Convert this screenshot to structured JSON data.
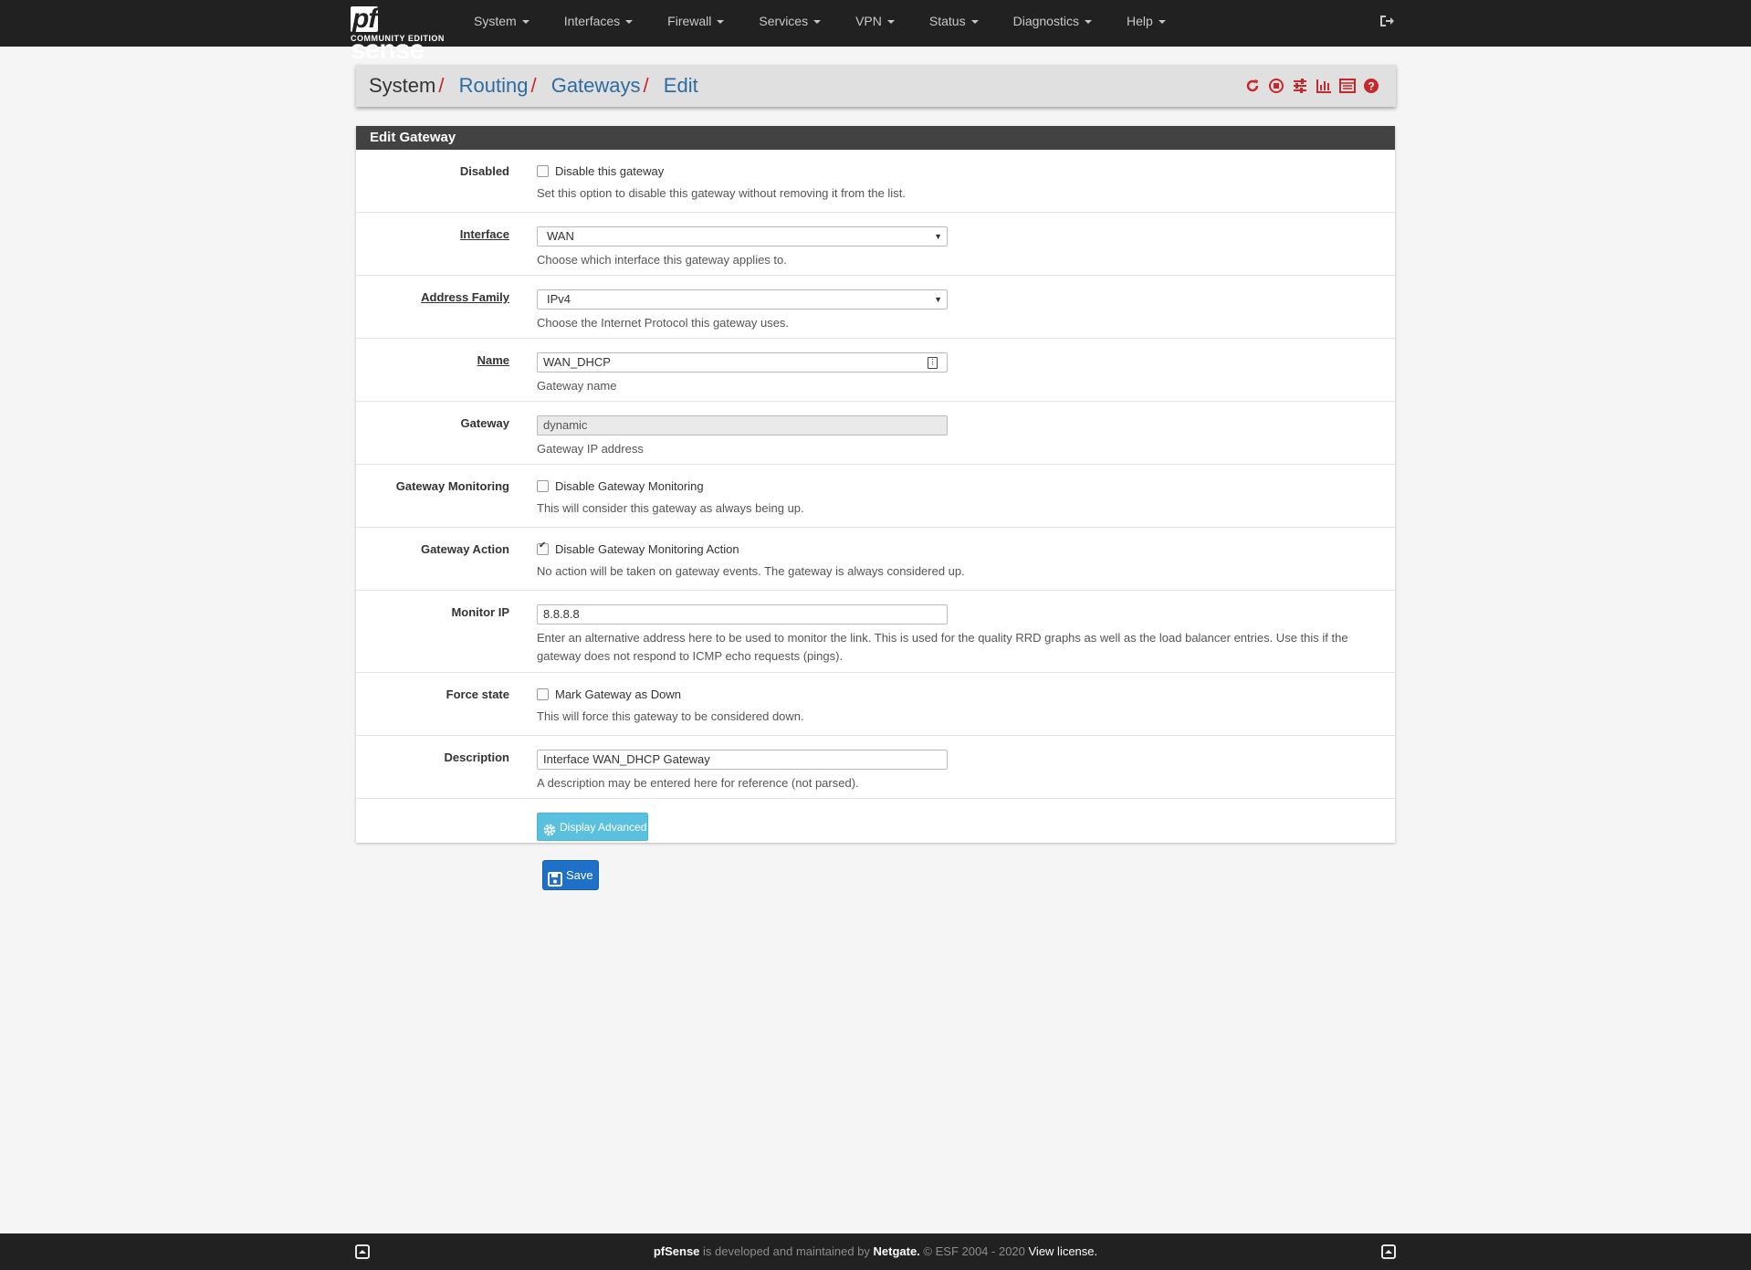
{
  "brand": {
    "name_pf": "pf",
    "name_rest": "sense",
    "edition": "COMMUNITY EDITION"
  },
  "nav": {
    "items": [
      "System",
      "Interfaces",
      "Firewall",
      "Services",
      "VPN",
      "Status",
      "Diagnostics",
      "Help"
    ]
  },
  "breadcrumb": {
    "system": "System",
    "routing": "Routing",
    "gateways": "Gateways",
    "edit": "Edit",
    "separator": "/"
  },
  "panel": {
    "title": "Edit Gateway",
    "fields": {
      "disabled": {
        "label": "Disabled",
        "checkbox_label": "Disable this gateway",
        "checked": false,
        "help": "Set this option to disable this gateway without removing it from the list."
      },
      "interface": {
        "label": "Interface",
        "value": "WAN",
        "help": "Choose which interface this gateway applies to."
      },
      "address_family": {
        "label": "Address Family",
        "value": "IPv4",
        "help": "Choose the Internet Protocol this gateway uses."
      },
      "name": {
        "label": "Name",
        "value": "WAN_DHCP",
        "help": "Gateway name"
      },
      "gateway": {
        "label": "Gateway",
        "value": "dynamic",
        "help": "Gateway IP address"
      },
      "monitoring": {
        "label": "Gateway Monitoring",
        "checkbox_label": "Disable Gateway Monitoring",
        "checked": false,
        "help": "This will consider this gateway as always being up."
      },
      "action": {
        "label": "Gateway Action",
        "checkbox_label": "Disable Gateway Monitoring Action",
        "checked": true,
        "help": "No action will be taken on gateway events. The gateway is always considered up."
      },
      "monitor_ip": {
        "label": "Monitor IP",
        "value": "8.8.8.8",
        "help": "Enter an alternative address here to be used to monitor the link. This is used for the quality RRD graphs as well as the load balancer entries. Use this if the gateway does not respond to ICMP echo requests (pings)."
      },
      "force_state": {
        "label": "Force state",
        "checkbox_label": "Mark Gateway as Down",
        "checked": false,
        "help": "This will force this gateway to be considered down."
      },
      "description": {
        "label": "Description",
        "value": "Interface WAN_DHCP Gateway",
        "help": "A description may be entered here for reference (not parsed)."
      }
    },
    "advanced_button": "Display Advanced"
  },
  "save_button": "Save",
  "footer": {
    "product": "pfSense",
    "text1": " is developed and maintained by ",
    "company": "Netgate.",
    "text2": " © ESF 2004 - 2020 ",
    "license": "View license."
  },
  "colors": {
    "navbar": "#212121",
    "accent_red": "#c7272d",
    "link_blue": "#2d6ca2",
    "info_button": "#5bc0de",
    "primary_button": "#1e70c9"
  }
}
